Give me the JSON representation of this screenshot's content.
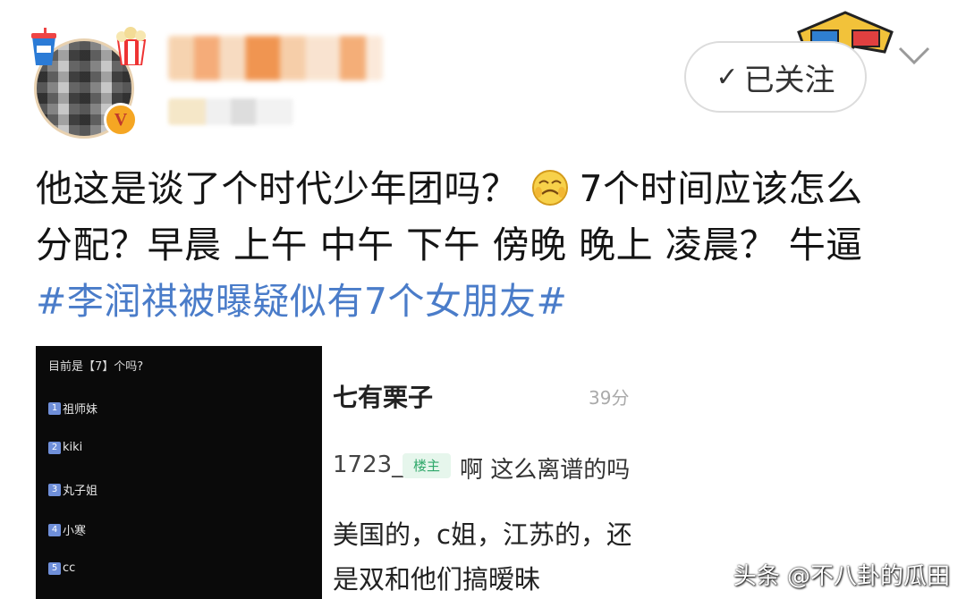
{
  "header": {
    "follow_check": "✓",
    "follow_label": "已关注",
    "verified_mark": "V"
  },
  "post": {
    "line1_a": "他这是谈了个时代少年团吗？",
    "line1_b": "7个时间应该怎么",
    "line2": "分配？早晨 上午 中午 下午 傍晚 晚上 凌晨？  牛逼",
    "hashtag": "#李润祺被曝疑似有7个女朋友#",
    "emoji": "smirk-face-icon"
  },
  "left_image": {
    "question": "目前是【7】个吗?",
    "options": [
      {
        "num": "1",
        "label": "祖师妹"
      },
      {
        "num": "2",
        "label": "kiki"
      },
      {
        "num": "3",
        "label": "丸子姐"
      },
      {
        "num": "4",
        "label": "小寒"
      },
      {
        "num": "5",
        "label": "cc"
      }
    ]
  },
  "right_image": {
    "title": "七有栗子",
    "time": "39分",
    "user": "1723_",
    "badge": "楼主",
    "reply": "啊 这么离谱的吗",
    "line1": "美国的，c姐，江苏的，还",
    "line2": "是双和他们搞暧昧"
  },
  "watermark": "头条 @不八卦的瓜田",
  "colors": {
    "hashtag": "#4a7cc9",
    "badge_bg": "#e6f6ec",
    "badge_text": "#2fa86a",
    "verified": "#f5a623"
  }
}
